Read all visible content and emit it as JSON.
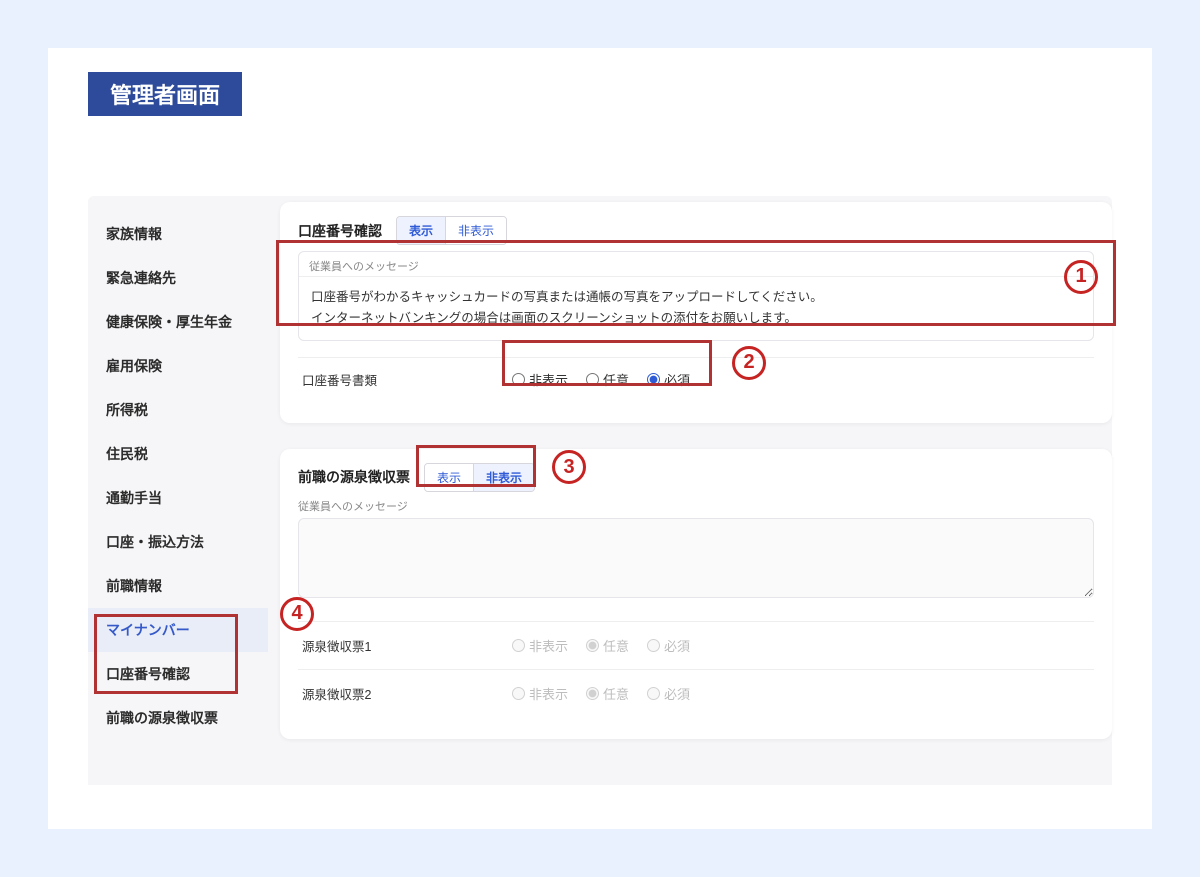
{
  "title": "管理者画面",
  "sidebar": {
    "items": [
      {
        "label": "家族情報"
      },
      {
        "label": "緊急連絡先"
      },
      {
        "label": "健康保険・厚生年金"
      },
      {
        "label": "雇用保険"
      },
      {
        "label": "所得税"
      },
      {
        "label": "住民税"
      },
      {
        "label": "通勤手当"
      },
      {
        "label": "口座・振込方法"
      },
      {
        "label": "前職情報"
      },
      {
        "label": "マイナンバー"
      },
      {
        "label": "口座番号確認"
      },
      {
        "label": "前職の源泉徴収票"
      }
    ]
  },
  "toggle": {
    "show": "表示",
    "hide": "非表示"
  },
  "msg_label": "従業員へのメッセージ",
  "radio": {
    "hidden": "非表示",
    "optional": "任意",
    "required": "必須"
  },
  "card1": {
    "title": "口座番号確認",
    "msg_body": "口座番号がわかるキャッシュカードの写真または通帳の写真をアップロードしてください。\nインターネットバンキングの場合は画面のスクリーンショットの添付をお願いします。",
    "row_label": "口座番号書類"
  },
  "card2": {
    "title": "前職の源泉徴収票",
    "rows": [
      {
        "label": "源泉徴収票1"
      },
      {
        "label": "源泉徴収票2"
      }
    ]
  },
  "annot": {
    "n1": "1",
    "n2": "2",
    "n3": "3",
    "n4": "4"
  }
}
